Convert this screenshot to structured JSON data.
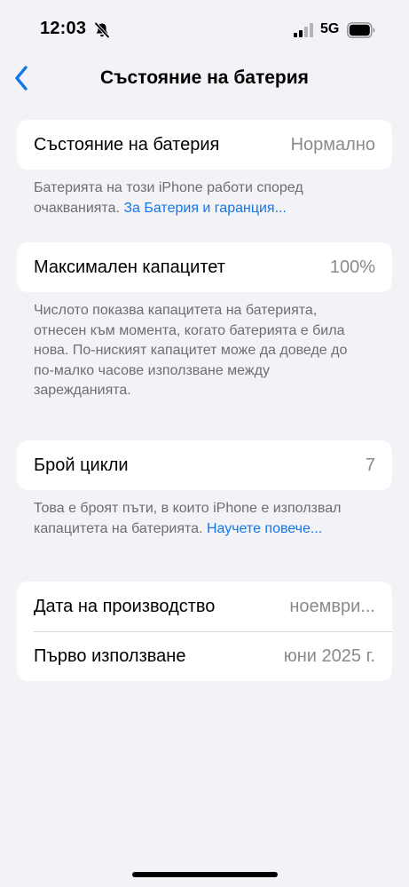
{
  "status_bar": {
    "time": "12:03",
    "network": "5G",
    "icons": [
      "bell-slash-icon",
      "signal-icon",
      "battery-icon"
    ]
  },
  "nav": {
    "back_icon": "chevron-left-icon",
    "title": "Състояние на батерия"
  },
  "battery_health": {
    "label": "Състояние на батерия",
    "value": "Нормално",
    "footnote_text": "Батерията на този iPhone работи според очакванията. ",
    "footnote_link": "За Батерия и гаранция..."
  },
  "max_capacity": {
    "label": "Максимален капацитет",
    "value": "100%",
    "footnote_text": "Числото показва капацитета на батерията, отнесен към момента, когато батерията е била нова. По-ниският капацитет може да доведе до по-малко часове използване между зарежданията."
  },
  "cycle_count": {
    "label": "Брой цикли",
    "value": "7",
    "footnote_text": "Това е броят пъти, в които iPhone е използвал капацитета на батерията. ",
    "footnote_link": "Научете повече..."
  },
  "dates": {
    "manufacture_label": "Дата на производство",
    "manufacture_value": "ноември...",
    "first_use_label": "Първо използване",
    "first_use_value": "юни 2025 г."
  },
  "colors": {
    "background": "#f2f2f7",
    "accent": "#1577e6",
    "secondary_text": "#8a8a8e"
  }
}
